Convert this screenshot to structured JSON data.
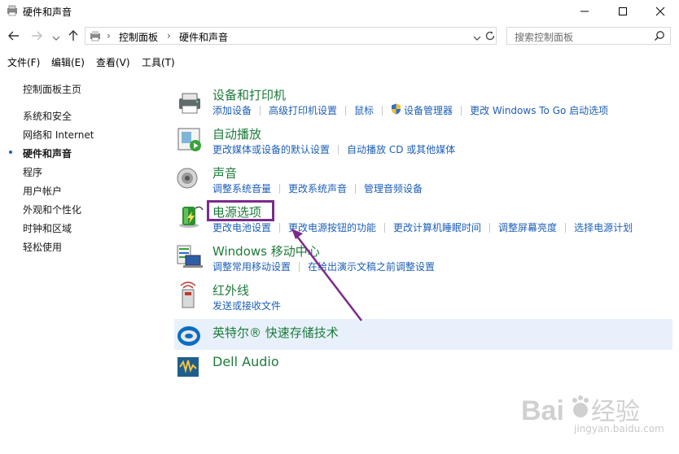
{
  "window": {
    "title": "硬件和声音",
    "minimize_label": "—",
    "maximize_label": "☐",
    "close_label": "✕"
  },
  "address": {
    "crumbs": [
      "控制面板",
      "硬件和声音"
    ],
    "search_placeholder": "搜索控制面板"
  },
  "menu": [
    "文件(F)",
    "编辑(E)",
    "查看(V)",
    "工具(T)"
  ],
  "sidebar": {
    "items": [
      {
        "label": "控制面板主页",
        "active": false
      },
      {
        "label": "系统和安全",
        "active": false
      },
      {
        "label": "网络和 Internet",
        "active": false
      },
      {
        "label": "硬件和声音",
        "active": true
      },
      {
        "label": "程序",
        "active": false
      },
      {
        "label": "用户帐户",
        "active": false
      },
      {
        "label": "外观和个性化",
        "active": false
      },
      {
        "label": "时钟和区域",
        "active": false
      },
      {
        "label": "轻松使用",
        "active": false
      }
    ]
  },
  "categories": [
    {
      "title": "设备和打印机",
      "icon": "printer-icon",
      "links": [
        "添加设备",
        "高级打印机设置",
        "鼠标",
        "设备管理器",
        "更改 Windows To Go 启动选项"
      ]
    },
    {
      "title": "自动播放",
      "icon": "autoplay-icon",
      "links": [
        "更改媒体或设备的默认设置",
        "自动播放 CD 或其他媒体"
      ]
    },
    {
      "title": "声音",
      "icon": "speaker-icon",
      "links": [
        "调整系统音量",
        "更改系统声音",
        "管理音频设备"
      ]
    },
    {
      "title": "电源选项",
      "icon": "battery-icon",
      "links": [
        "更改电池设置",
        "更改电源按钮的功能",
        "更改计算机睡眠时间",
        "调整屏幕亮度",
        "选择电源计划"
      ]
    },
    {
      "title": "Windows 移动中心",
      "icon": "mobility-center-icon",
      "links": [
        "调整常用移动设置",
        "在给出演示文稿之前调整设置"
      ]
    },
    {
      "title": "红外线",
      "icon": "infrared-icon",
      "links": [
        "发送或接收文件"
      ]
    },
    {
      "title": "英特尔® 快速存储技术",
      "icon": "intel-rst-icon",
      "links": []
    },
    {
      "title": "Dell Audio",
      "icon": "dell-audio-icon",
      "links": []
    }
  ],
  "watermark": {
    "text": "Baidu经验",
    "url": "jingyan.baidu.com"
  },
  "colors": {
    "link": "#1d5fb7",
    "category_title": "#1e7a3c",
    "annotation": "#7b2a8a",
    "hover_row": "#e8f1fb"
  }
}
